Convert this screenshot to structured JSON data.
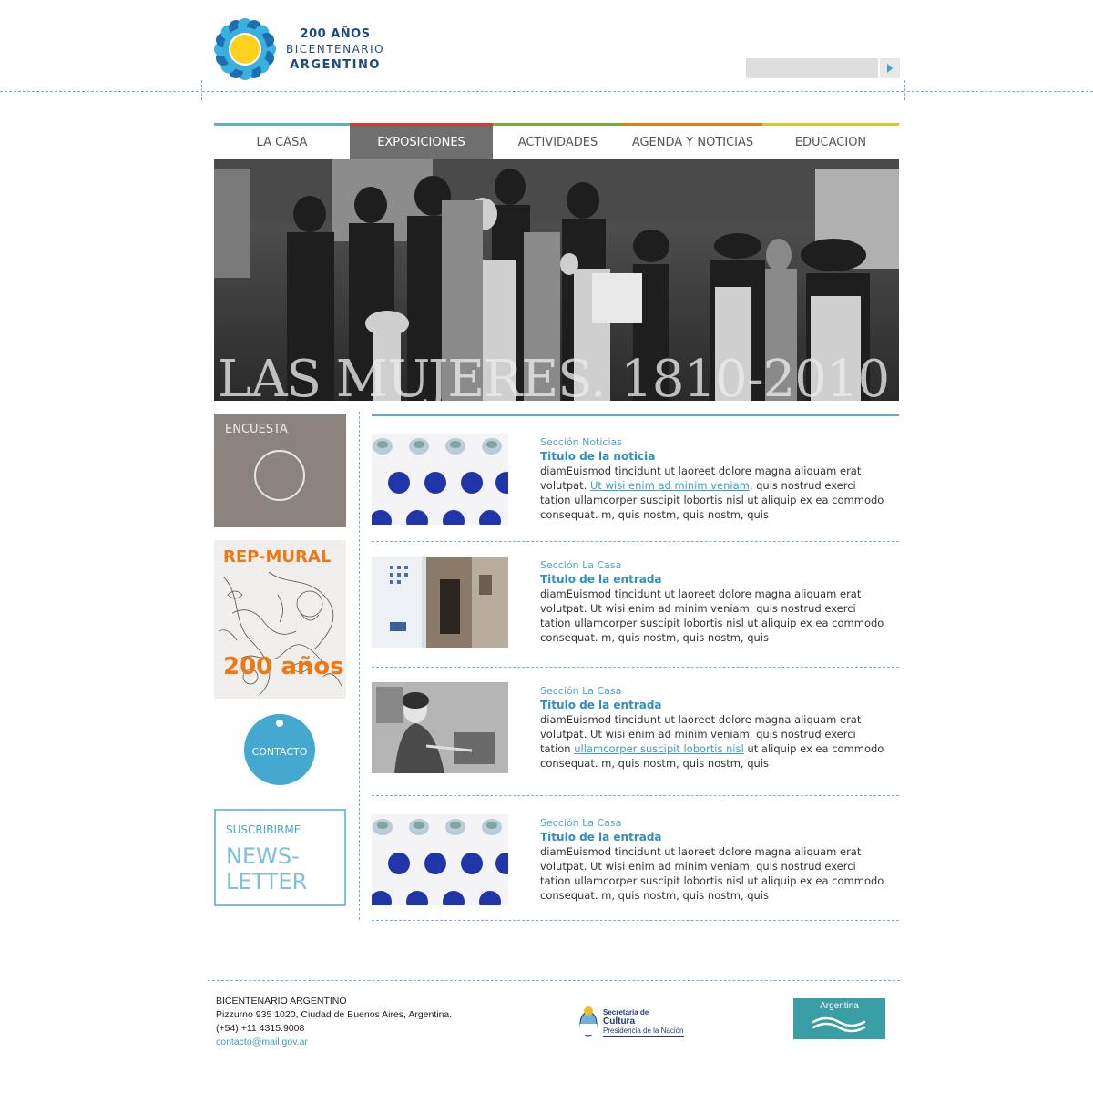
{
  "header": {
    "logo": {
      "line1": "200 AÑOS",
      "line2": "BICENTENARIO",
      "line3": "ARGENTINO"
    },
    "search": {
      "value": "",
      "placeholder": ""
    }
  },
  "nav": {
    "items": [
      {
        "label": "LA CASA",
        "color": "#5aaed2",
        "active": false
      },
      {
        "label": "EXPOSICIONES",
        "color": "#d43a2c",
        "active": true
      },
      {
        "label": "ACTIVIDADES",
        "color": "#6fb03b",
        "active": false
      },
      {
        "label": "AGENDA Y NOTICIAS",
        "color": "#e07a1f",
        "active": false
      },
      {
        "label": "EDUCACION",
        "color": "#e2c12f",
        "active": false
      }
    ]
  },
  "hero": {
    "title": "LAS MUJERES. 1810-2010"
  },
  "sidebar": {
    "poll": {
      "label": "ENCUESTA"
    },
    "mural": {
      "title": "REP-MURAL",
      "subtitle": "200 años"
    },
    "contact": {
      "label": "CONTACTO"
    },
    "newsletter": {
      "top": "SUSCRIBIRME",
      "line1": "NEWS-",
      "line2": "LETTER"
    }
  },
  "articles": [
    {
      "section": "Sección Noticias",
      "title": "Titulo de la noticia",
      "text_before": "diamEuismod tincidunt ut laoreet dolore magna aliquam erat volutpat. ",
      "link": "Ut wisi enim ad minim veniam",
      "text_after": ", quis nostrud exerci tation ullamcorper suscipit lobortis nisl ut aliquip ex ea commodo consequat. m, quis nostm, quis nostm, quis"
    },
    {
      "section": "Sección La Casa",
      "title": "Titulo de la entrada",
      "text_before": "diamEuismod tincidunt ut laoreet dolore magna aliquam erat volutpat. Ut wisi enim ad minim veniam, quis nostrud exerci tation ullamcorper suscipit lobortis nisl ut aliquip ex ea commodo consequat. m, quis nostm, quis nostm, quis",
      "link": "",
      "text_after": ""
    },
    {
      "section": "Sección La Casa",
      "title": "Titulo de la entrada",
      "text_before": "diamEuismod tincidunt ut laoreet dolore magna aliquam erat volutpat. Ut wisi enim ad minim veniam, quis nostrud exerci tation ",
      "link": "ullamcorper suscipit lobortis nisl",
      "text_after": " ut aliquip ex ea commodo consequat. m, quis nostm, quis nostm, quis"
    },
    {
      "section": "Sección La Casa",
      "title": "Titulo de la entrada",
      "text_before": "diamEuismod tincidunt ut laoreet dolore magna aliquam erat volutpat. Ut wisi enim ad minim veniam, quis nostrud exerci tation ullamcorper suscipit lobortis nisl ut aliquip ex ea commodo consequat. m, quis nostm, quis nostm, quis",
      "link": "",
      "text_after": ""
    }
  ],
  "footer": {
    "name": "BICENTENARIO ARGENTINO",
    "address": "Pizzurno 935  1020, Ciudad de Buenos Aires, Argentina.",
    "phone": "(+54) +11 4315.9008",
    "email": "contacto@mail.gov.ar",
    "cultura": {
      "line1": "Secretaría de",
      "line2": "Cultura",
      "line3": "Presidencia de la Nación"
    },
    "argentina_logo": "Argentina"
  },
  "colors": {
    "accent": "#45a8cf",
    "poll_bg": "#8b837e",
    "mural_orange": "#f07813"
  }
}
